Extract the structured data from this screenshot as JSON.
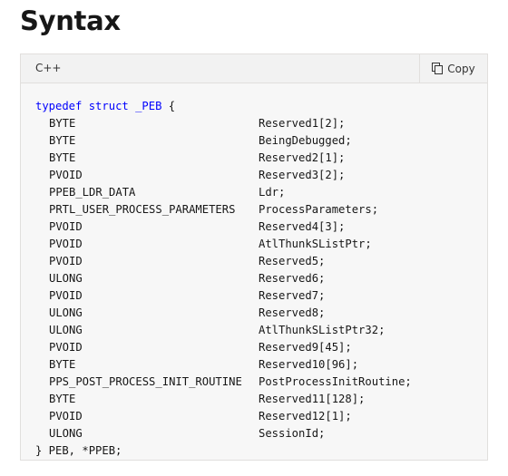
{
  "heading": "Syntax",
  "code_block": {
    "language": "C++",
    "copy_label": "Copy",
    "copy_icon": "copy-icon",
    "keyword_color": "#0101fd",
    "opening": {
      "kw1": "typedef",
      "kw2": "struct",
      "tag": "_PEB",
      "brace": "{"
    },
    "fields": [
      {
        "type": "BYTE",
        "name": "Reserved1[2];"
      },
      {
        "type": "BYTE",
        "name": "BeingDebugged;"
      },
      {
        "type": "BYTE",
        "name": "Reserved2[1];"
      },
      {
        "type": "PVOID",
        "name": "Reserved3[2];"
      },
      {
        "type": "PPEB_LDR_DATA",
        "name": "Ldr;"
      },
      {
        "type": "PRTL_USER_PROCESS_PARAMETERS",
        "name": "ProcessParameters;"
      },
      {
        "type": "PVOID",
        "name": "Reserved4[3];"
      },
      {
        "type": "PVOID",
        "name": "AtlThunkSListPtr;"
      },
      {
        "type": "PVOID",
        "name": "Reserved5;"
      },
      {
        "type": "ULONG",
        "name": "Reserved6;"
      },
      {
        "type": "PVOID",
        "name": "Reserved7;"
      },
      {
        "type": "ULONG",
        "name": "Reserved8;"
      },
      {
        "type": "ULONG",
        "name": "AtlThunkSListPtr32;"
      },
      {
        "type": "PVOID",
        "name": "Reserved9[45];"
      },
      {
        "type": "BYTE",
        "name": "Reserved10[96];"
      },
      {
        "type": "PPS_POST_PROCESS_INIT_ROUTINE",
        "name": "PostProcessInitRoutine;"
      },
      {
        "type": "BYTE",
        "name": "Reserved11[128];"
      },
      {
        "type": "PVOID",
        "name": "Reserved12[1];"
      },
      {
        "type": "ULONG",
        "name": "SessionId;"
      }
    ],
    "closing": "} PEB, *PPEB;"
  }
}
